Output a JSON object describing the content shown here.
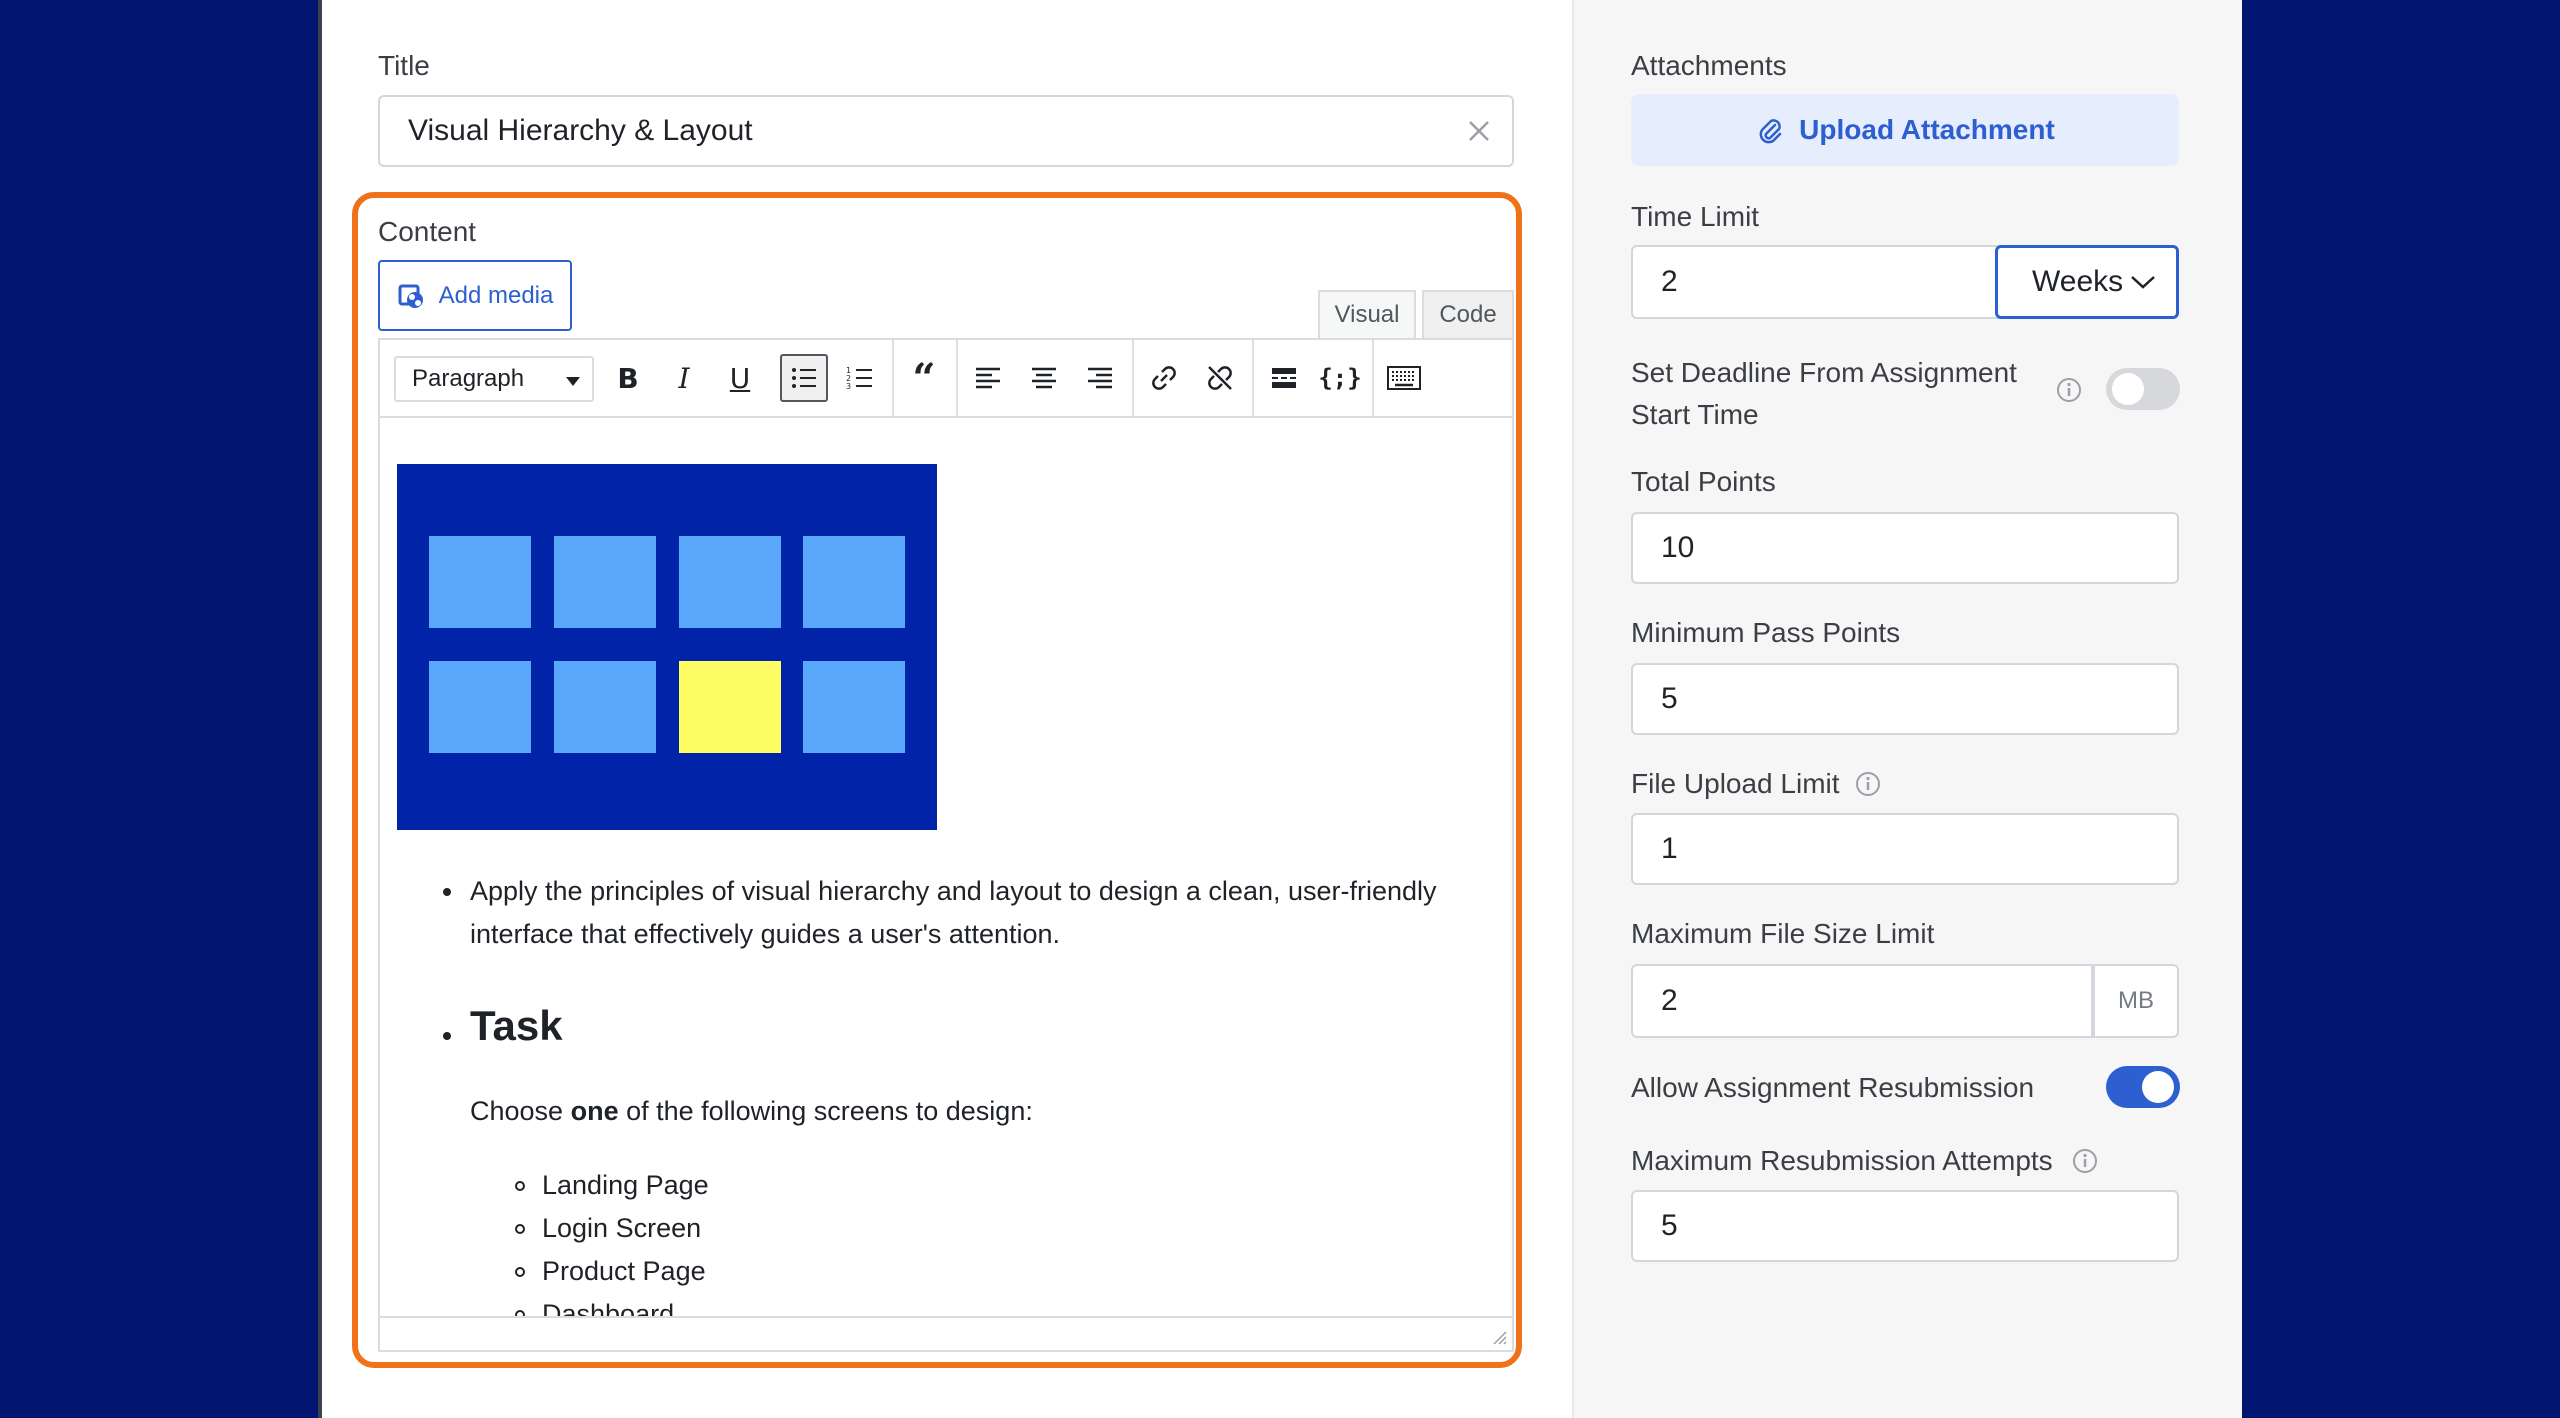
{
  "title_field": {
    "label": "Title",
    "value": "Visual Hierarchy & Layout"
  },
  "content": {
    "label": "Content",
    "add_media_label": "Add media",
    "tabs": {
      "visual": "Visual",
      "code": "Code"
    },
    "format_select": "Paragraph",
    "body": {
      "bullet_1_line_1": "Apply the principles of visual hierarchy and layout to design a clean, user-friendly",
      "bullet_1_line_2": "interface that effectively guides a user's attention.",
      "task_heading": "Task",
      "choose_prefix": "Choose ",
      "choose_bold": "one",
      "choose_suffix": " of the following screens to design:",
      "screens": [
        "Landing Page",
        "Login Screen",
        "Product Page",
        "Dashboard"
      ]
    }
  },
  "attachments": {
    "label": "Attachments",
    "upload_label": "Upload Attachment"
  },
  "time_limit": {
    "label": "Time Limit",
    "value": "2",
    "unit": "Weeks"
  },
  "deadline": {
    "label_line_1": "Set Deadline From Assignment",
    "label_line_2": "Start Time",
    "enabled": false
  },
  "total_points": {
    "label": "Total Points",
    "value": "10"
  },
  "min_pass_points": {
    "label": "Minimum Pass Points",
    "value": "5"
  },
  "file_upload_limit": {
    "label": "File Upload Limit",
    "value": "1"
  },
  "max_file_size": {
    "label": "Maximum File Size Limit",
    "value": "2",
    "unit": "MB"
  },
  "resubmission": {
    "label": "Allow Assignment Resubmission",
    "enabled": true
  },
  "max_resubmission": {
    "label": "Maximum Resubmission Attempts",
    "value": "5"
  },
  "colors": {
    "accent": "#2d5fd0",
    "highlight": "#f07218",
    "background": "#011570",
    "hero": "#0123a7",
    "tile": "#5aa8fb",
    "tile_active": "#fefd64"
  }
}
